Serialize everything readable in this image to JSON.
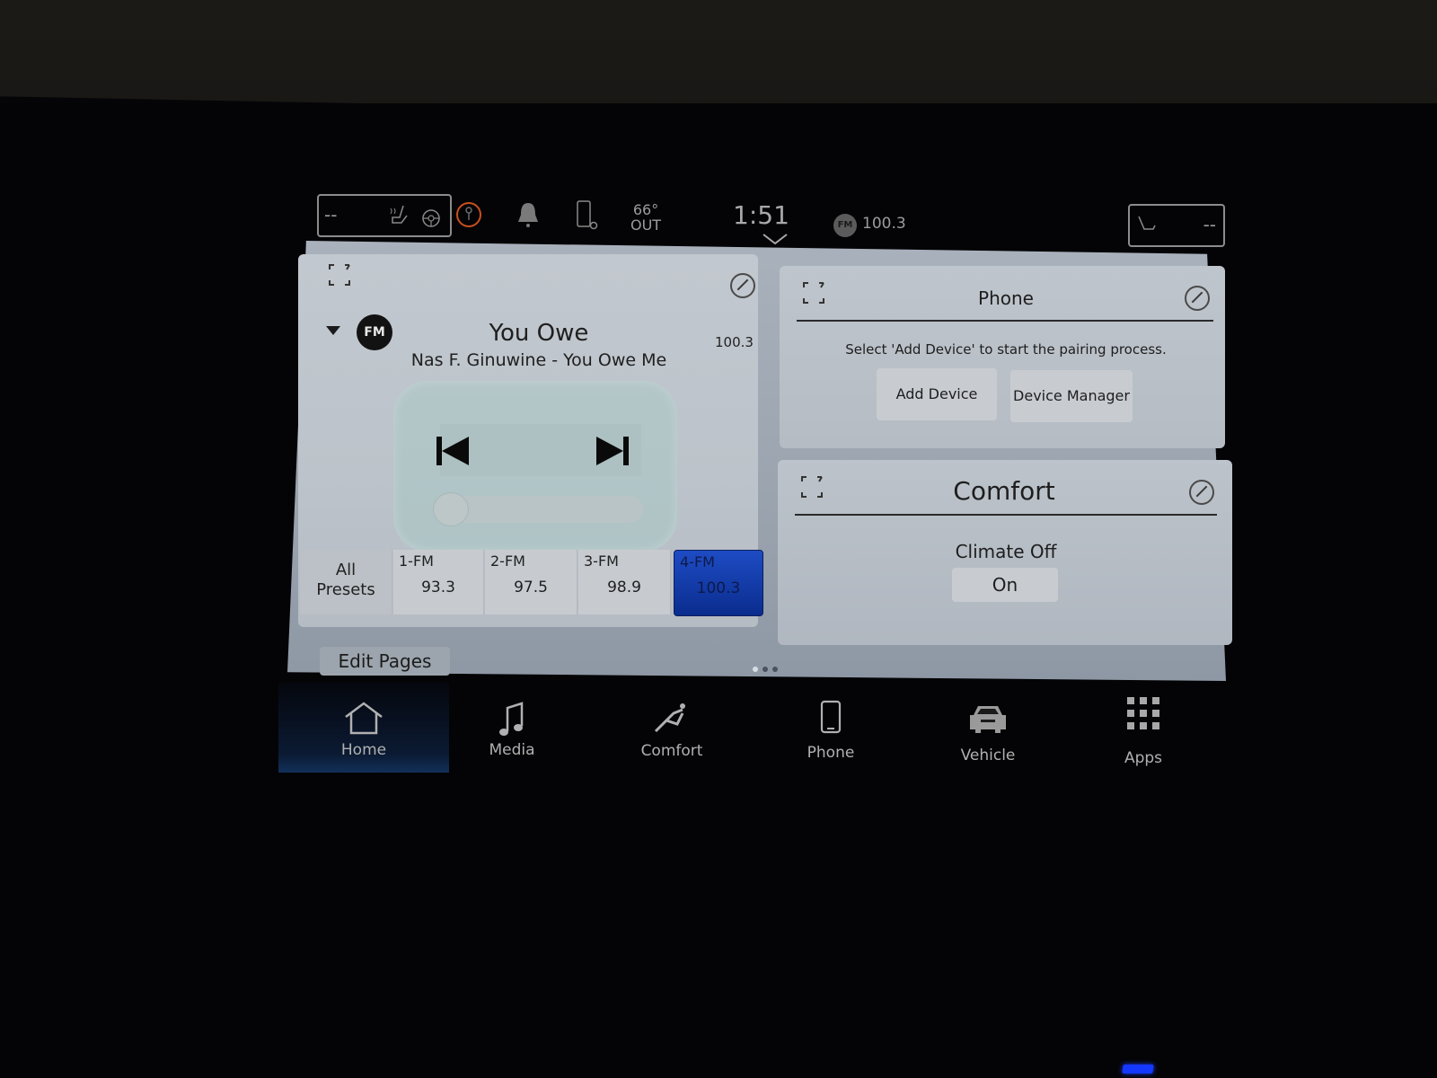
{
  "status_bar": {
    "driver_seat_value": "--",
    "passenger_seat_value": "--",
    "driver_seat_icon": "heated-seat-icon",
    "steering_icon": "heated-steering-wheel-icon",
    "alert_icon": "key-alert-icon",
    "notification_icon": "bell-icon",
    "phone_settings_icon": "phone-settings-icon",
    "temperature": "66°",
    "temperature_label": "OUT",
    "time": "1:51",
    "source_badge": "FM",
    "source_frequency": "100.3",
    "passenger_seat_icon": "ventilated-seat-icon"
  },
  "media_card": {
    "source": "FM",
    "song_title": "You Owe",
    "song_artist": "Nas F. Ginuwine - You Owe Me",
    "frequency": "100.3",
    "prev_icon": "skip-previous-icon",
    "next_icon": "skip-next-icon",
    "all_presets_line1": "All",
    "all_presets_line2": "Presets",
    "presets": [
      {
        "label": "1-FM",
        "frequency": "93.3",
        "active": false
      },
      {
        "label": "2-FM",
        "frequency": "97.5",
        "active": false
      },
      {
        "label": "3-FM",
        "frequency": "98.9",
        "active": false
      },
      {
        "label": "4-FM",
        "frequency": "100.3",
        "active": true
      }
    ]
  },
  "phone_card": {
    "title": "Phone",
    "message": "Select 'Add Device' to start the pairing process.",
    "add_device_label": "Add Device",
    "device_manager_label": "Device Manager"
  },
  "comfort_card": {
    "title": "Comfort",
    "status": "Climate Off",
    "toggle_label": "On"
  },
  "footer": {
    "edit_pages_label": "Edit Pages",
    "page_count": 3,
    "current_page": 1
  },
  "nav": [
    {
      "label": "Home",
      "icon": "home-icon",
      "active": true
    },
    {
      "label": "Media",
      "icon": "music-note-icon",
      "active": false
    },
    {
      "label": "Comfort",
      "icon": "seat-recline-icon",
      "active": false
    },
    {
      "label": "Phone",
      "icon": "smartphone-icon",
      "active": false
    },
    {
      "label": "Vehicle",
      "icon": "car-icon",
      "active": false
    },
    {
      "label": "Apps",
      "icon": "apps-grid-icon",
      "active": false
    }
  ],
  "colors": {
    "active_preset": "#1a3fb0",
    "alert_ring": "#c8501e",
    "led_indicator": "#1438ff"
  }
}
